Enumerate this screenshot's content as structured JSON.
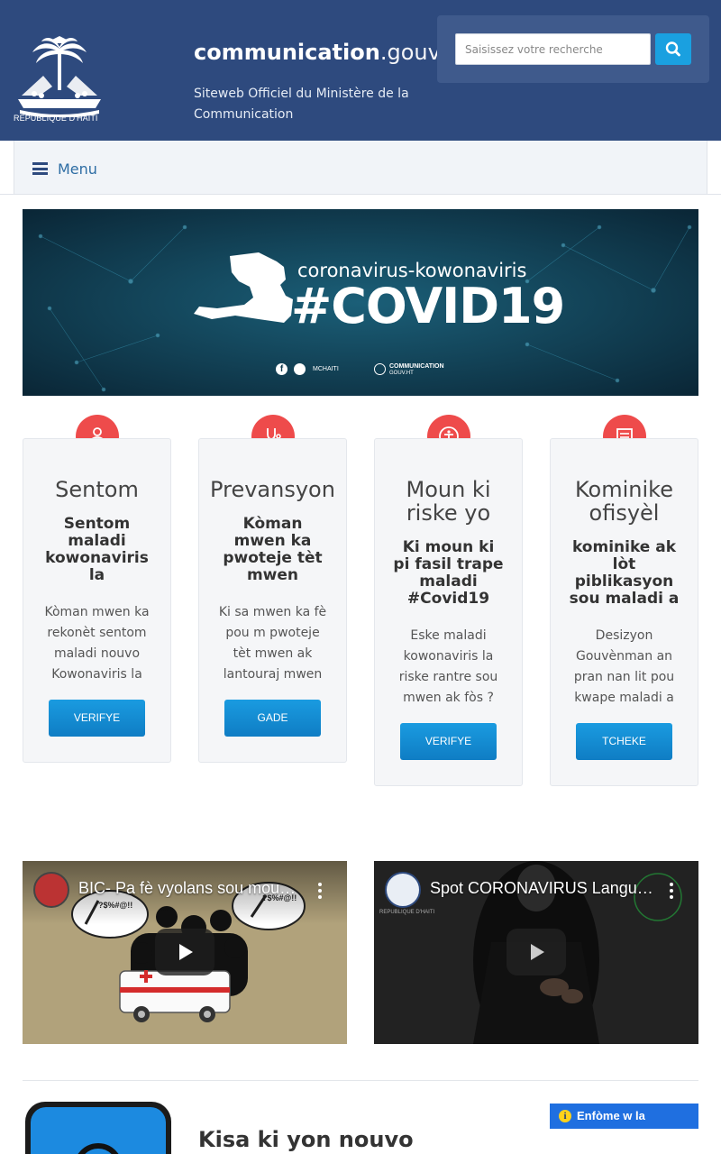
{
  "header": {
    "logo_text": "REPUBLIQUE D'HAITI",
    "site_name_bold": "communication",
    "site_name_rest": ".gouv.ht",
    "tagline": "Siteweb Officiel du Ministère de la Communication",
    "search": {
      "placeholder": "Saisissez votre recherche"
    }
  },
  "nav": {
    "menu_label": "Menu"
  },
  "banner": {
    "subtitle": "coronavirus-kowonaviris",
    "title": "#COVID19",
    "handle": "MCHAITI",
    "site_line1": "COMMUNICATION",
    "site_line2": "GOUV.HT"
  },
  "cards": [
    {
      "icon": "doctor-icon",
      "title": "Sentom",
      "subtitle": "Sentom maladi kowonaviris la",
      "description": "Kòman mwen ka rekonèt sentom maladi nouvo Kowonaviris la",
      "button": "VERIFYE"
    },
    {
      "icon": "stethoscope-icon",
      "title": "Prevansyon",
      "subtitle": "Kòman mwen ka pwoteje tèt mwen",
      "description": "Ki sa mwen ka fè pou m pwoteje tèt mwen ak lantouraj mwen",
      "button": "GADE"
    },
    {
      "icon": "accessibility-icon",
      "title": "Moun ki riske yo",
      "subtitle": "Ki moun ki pi fasil trape maladi #Covid19",
      "description": "Eske maladi kowonaviris la riske rantre sou mwen ak fòs ?",
      "button": "VERIFYE"
    },
    {
      "icon": "document-icon",
      "title": "Kominike ofisyèl",
      "subtitle": "kominike ak lòt piblikasyon sou maladi a",
      "description": "Desizyon Gouvènman an pran nan lit pou kwape maladi a",
      "button": "TCHEKE"
    }
  ],
  "videos": [
    {
      "title": "BIC- Pa fè vyolans sou moun ki malad",
      "bubble_text": "?$%#@!!"
    },
    {
      "title": "Spot CORONAVIRUS Langue des signes",
      "channel_caption": "REPUBLIQUE D'HAITI"
    }
  ],
  "bottom": {
    "heading": "Kisa ki yon nouvo",
    "enfome_label": "Enfòme w la"
  },
  "colors": {
    "header_bg": "#2e4a7e",
    "accent_blue": "#1aa0e0",
    "icon_red": "#ee4b4b",
    "button_blue": "#138ad2"
  }
}
